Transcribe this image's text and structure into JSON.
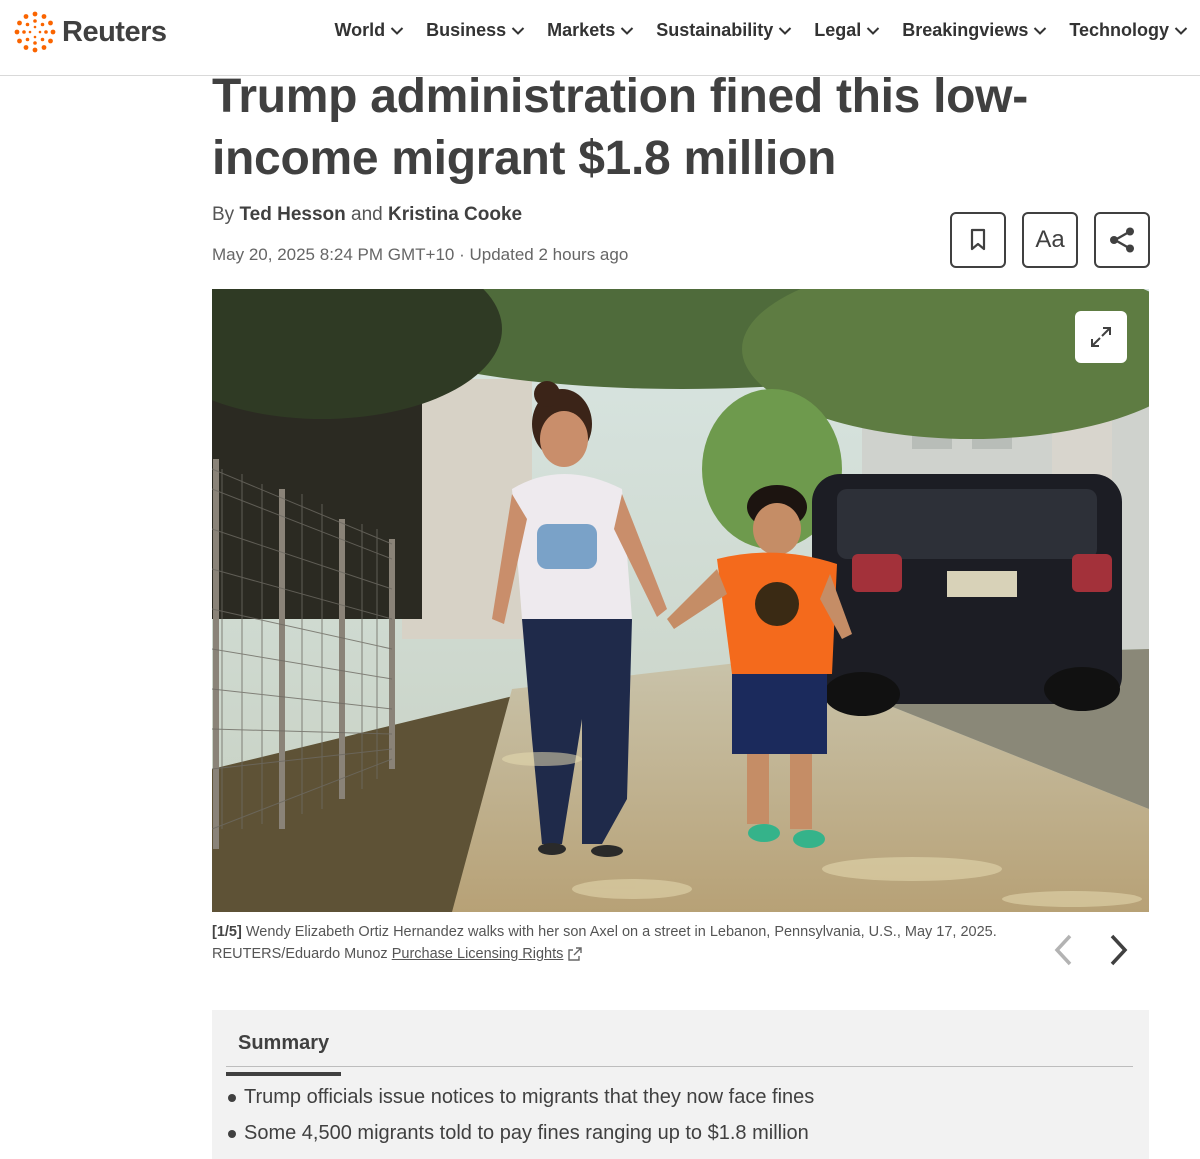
{
  "brand": {
    "name": "Reuters",
    "accent": "#FA6400"
  },
  "nav": {
    "items": [
      {
        "label": "World"
      },
      {
        "label": "Business"
      },
      {
        "label": "Markets"
      },
      {
        "label": "Sustainability"
      },
      {
        "label": "Legal"
      },
      {
        "label": "Breakingviews"
      },
      {
        "label": "Technology"
      }
    ]
  },
  "article": {
    "headline": "Trump administration fined this low-income migrant $1.8 million",
    "byline_prefix": "By",
    "author_1": "Ted Hesson",
    "byline_and": "and",
    "author_2": "Kristina Cooke",
    "date": "May 20, 2025 8:24 PM GMT+10",
    "updated": "· Updated 2 hours ago"
  },
  "tools": {
    "bookmark_icon": "bookmark-icon",
    "font_size_label": "Aa",
    "share_icon": "share-icon"
  },
  "photo": {
    "counter": "[1/5]",
    "caption": "Wendy Elizabeth Ortiz Hernandez walks with her son Axel on a street in Lebanon, Pennsylvania, U.S., May 17, 2025.",
    "credit": "REUTERS/Eduardo Munoz",
    "licensing_link": "Purchase Licensing Rights"
  },
  "summary": {
    "title": "Summary",
    "bullets": [
      "Trump officials issue notices to migrants that they now face fines",
      "Some 4,500 migrants told to pay fines ranging up to $1.8 million"
    ]
  }
}
